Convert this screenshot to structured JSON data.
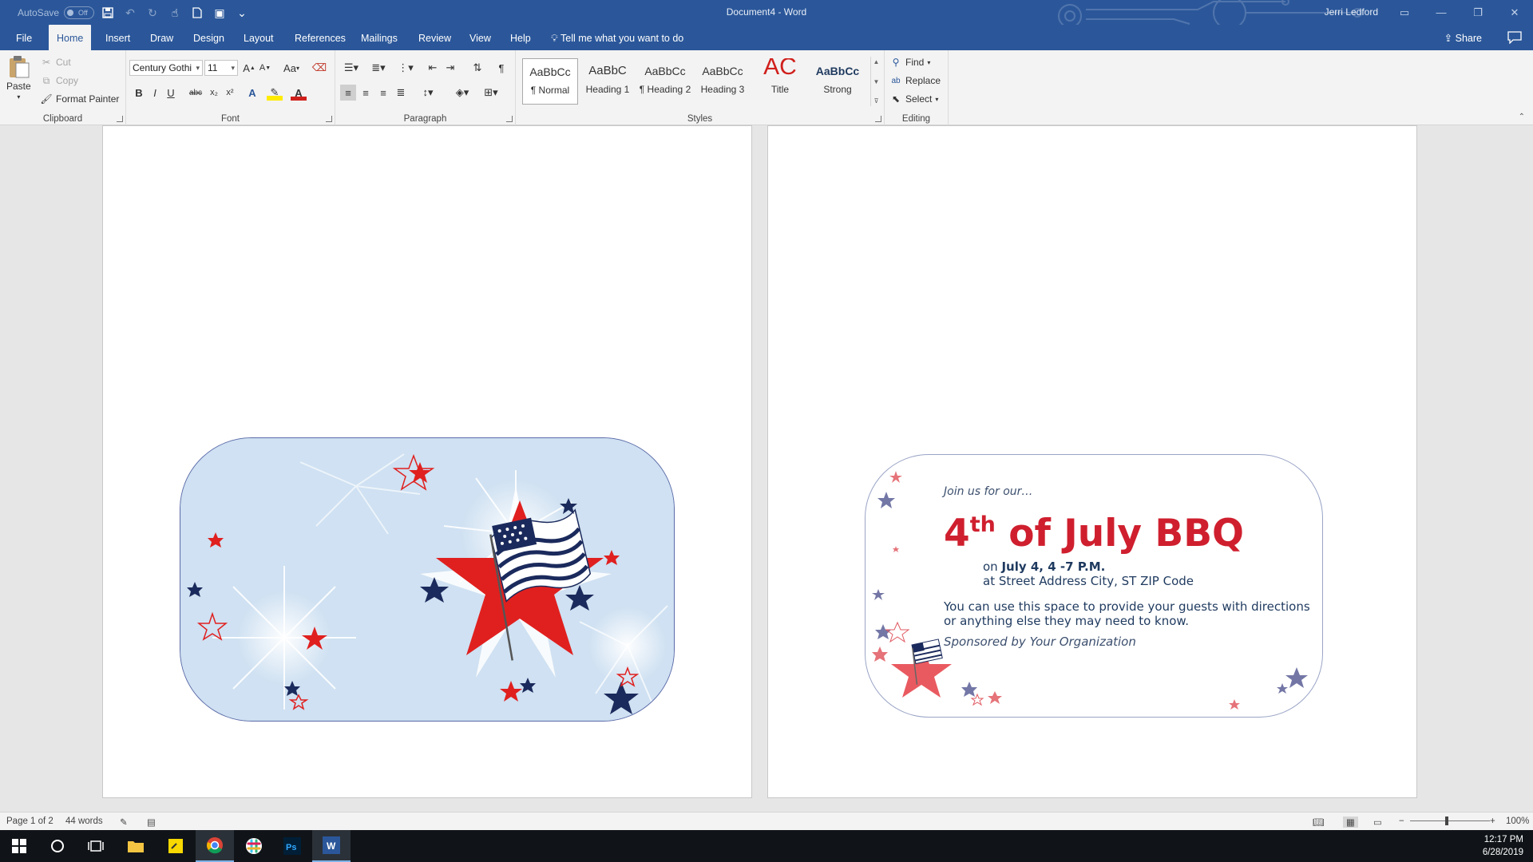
{
  "titlebar": {
    "autosave_label": "AutoSave",
    "autosave_state": "Off",
    "document_title": "Document4 - Word",
    "user_name": "Jerri Ledford"
  },
  "tabs": [
    "File",
    "Home",
    "Insert",
    "Draw",
    "Design",
    "Layout",
    "References",
    "Mailings",
    "Review",
    "View",
    "Help"
  ],
  "active_tab": "Home",
  "tell_me": "Tell me what you want to do",
  "share_label": "Share",
  "ribbon": {
    "clipboard": {
      "label": "Clipboard",
      "paste": "Paste",
      "cut": "Cut",
      "copy": "Copy",
      "format_painter": "Format Painter"
    },
    "font": {
      "label": "Font",
      "font_name": "Century Gothi",
      "font_size": "11",
      "bold": "B",
      "italic": "I",
      "underline": "U",
      "strike": "abc",
      "sub": "x₂",
      "sup": "x²",
      "change_case": "Aa",
      "grow": "A",
      "shrink": "A"
    },
    "paragraph": {
      "label": "Paragraph"
    },
    "styles": {
      "label": "Styles",
      "items": [
        {
          "sample": "AaBbCc",
          "name": "¶ Normal"
        },
        {
          "sample": "AaBbC",
          "name": "Heading 1"
        },
        {
          "sample": "AaBbCc",
          "name": "¶ Heading 2"
        },
        {
          "sample": "AaBbCc",
          "name": "Heading 3"
        },
        {
          "sample": "AC",
          "name": "Title"
        },
        {
          "sample": "AaBbCc",
          "name": "Strong"
        }
      ]
    },
    "editing": {
      "label": "Editing",
      "find": "Find",
      "replace": "Replace",
      "select": "Select"
    }
  },
  "invite": {
    "intro": "Join us for our…",
    "headline_num": "4",
    "headline_sup": "th",
    "headline_rest": " of July BBQ",
    "date_prefix": "on ",
    "date": "July 4, 4 -7 P.M.",
    "address": "at Street Address City, ST ZIP Code",
    "body": "You can use this space to provide your guests with directions or anything else they may need to know.",
    "sponsor": "Sponsored by Your Organization"
  },
  "statusbar": {
    "page": "Page 1 of 2",
    "words": "44 words",
    "zoom": "100%"
  },
  "clock": {
    "time": "12:17 PM",
    "date": "6/28/2019"
  },
  "colors": {
    "word_blue": "#2b579a",
    "headline_red": "#cf1f2e",
    "navy_text": "#1f3a5f",
    "card_sky": "#cfe1f2"
  }
}
